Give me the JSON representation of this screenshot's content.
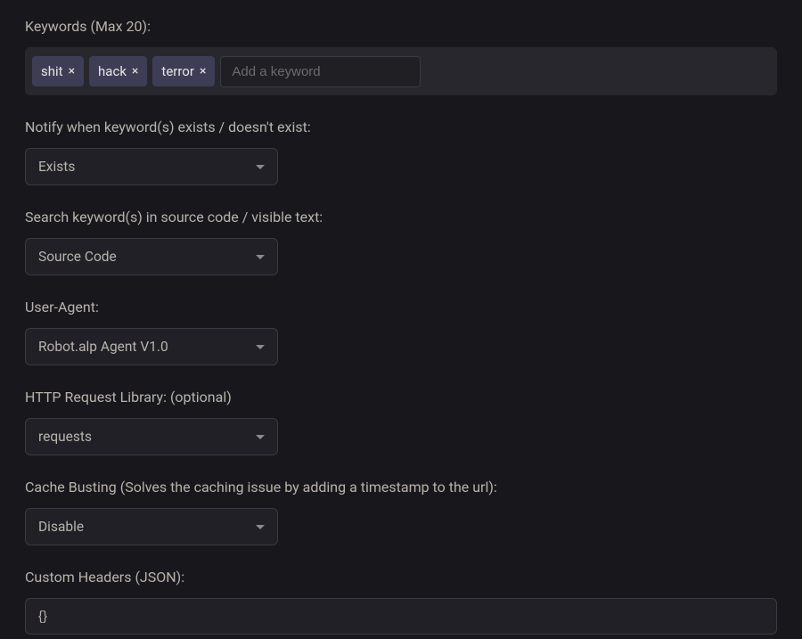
{
  "keywords_section": {
    "label": "Keywords (Max 20):",
    "tags": [
      {
        "text": "shit"
      },
      {
        "text": "hack"
      },
      {
        "text": "terror"
      }
    ],
    "tag_remove_glyph": "×",
    "input_placeholder": "Add a keyword"
  },
  "notify_section": {
    "label": "Notify when keyword(s) exists / doesn't exist:",
    "value": "Exists"
  },
  "search_in_section": {
    "label": "Search keyword(s) in source code / visible text:",
    "value": "Source Code"
  },
  "user_agent_section": {
    "label": "User-Agent:",
    "value": "Robot.alp Agent V1.0"
  },
  "http_lib_section": {
    "label": "HTTP Request Library: (optional)",
    "value": "requests"
  },
  "cache_busting_section": {
    "label": "Cache Busting (Solves the caching issue by adding a timestamp to the url):",
    "value": "Disable"
  },
  "custom_headers_section": {
    "label": "Custom Headers (JSON):",
    "value": "{}"
  }
}
